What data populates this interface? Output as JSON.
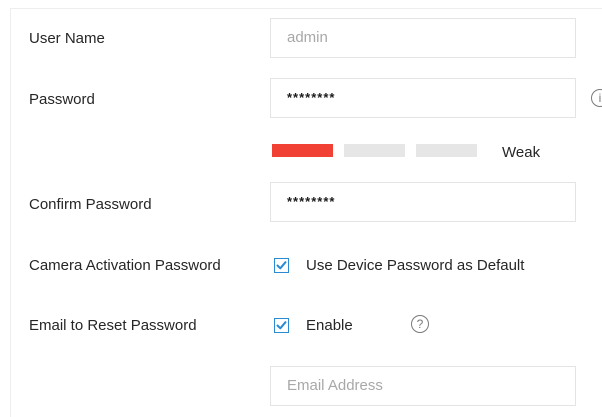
{
  "form": {
    "user_name": {
      "label": "User Name",
      "value": "admin"
    },
    "password": {
      "label": "Password",
      "value": "********",
      "info_icon": "i"
    },
    "strength": {
      "text": "Weak",
      "level": 1,
      "segments": 3,
      "active_color": "#f04134",
      "inactive_color": "#e6e6e6"
    },
    "confirm_password": {
      "label": "Confirm Password",
      "value": "********"
    },
    "camera_activation": {
      "label": "Camera Activation Password",
      "checkbox_label": "Use Device Password as Default",
      "checked": true
    },
    "email_reset": {
      "label": "Email to Reset Password",
      "checkbox_label": "Enable",
      "checked": true,
      "help_icon": "?"
    },
    "email_address": {
      "placeholder": "Email Address"
    }
  },
  "colors": {
    "accent": "#2a8bd2",
    "weak": "#f04134"
  },
  "icons": {
    "info": "info-icon",
    "help": "question-icon",
    "check": "checkmark-icon"
  }
}
